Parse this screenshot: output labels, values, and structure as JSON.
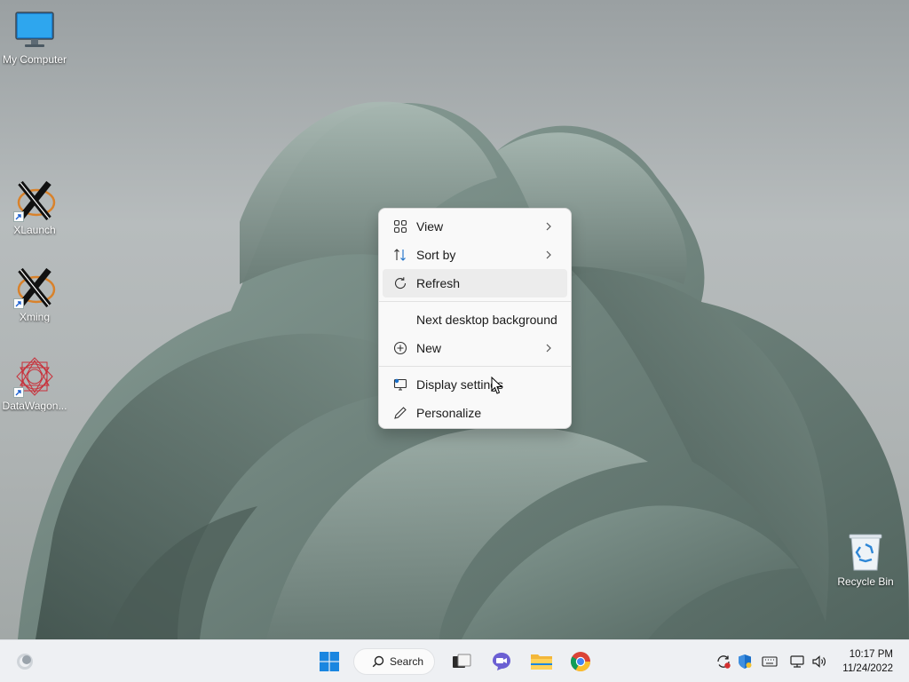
{
  "desktop": {
    "icons": [
      {
        "label": "My Computer",
        "icon": "monitor-icon"
      },
      {
        "label": "XLaunch",
        "icon": "xlaunch-icon"
      },
      {
        "label": "Xming",
        "icon": "xming-icon"
      },
      {
        "label": "DataWagon...",
        "icon": "datawagon-icon"
      },
      {
        "label": "Recycle Bin",
        "icon": "recycle-bin-icon"
      }
    ]
  },
  "context_menu": {
    "items": [
      {
        "label": "View",
        "icon": "grid-icon",
        "submenu": true
      },
      {
        "label": "Sort by",
        "icon": "sort-icon",
        "submenu": true
      },
      {
        "label": "Refresh",
        "icon": "refresh-icon",
        "submenu": false,
        "hovered": true
      },
      {
        "label": "Next desktop background",
        "icon": "",
        "submenu": false
      },
      {
        "label": "New",
        "icon": "plus-circle-icon",
        "submenu": true
      },
      {
        "label": "Display settings",
        "icon": "display-icon",
        "submenu": false
      },
      {
        "label": "Personalize",
        "icon": "pen-icon",
        "submenu": false
      }
    ]
  },
  "taskbar": {
    "search_label": "Search",
    "apps": [
      "start-icon",
      "search-icon",
      "task-view-icon",
      "chat-icon",
      "file-explorer-icon",
      "chrome-icon"
    ],
    "tray": [
      "update-icon",
      "security-icon",
      "keyboard-icon",
      "network-icon",
      "volume-icon"
    ],
    "clock": {
      "time": "10:17 PM",
      "date": "11/24/2022"
    }
  },
  "colors": {
    "accent": "#0067c0",
    "menu_bg": "#f9f9f9",
    "taskbar_bg": "#eef0f3"
  }
}
